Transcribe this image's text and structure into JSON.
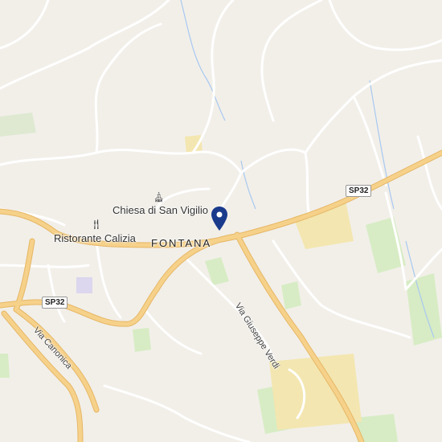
{
  "map": {
    "colors": {
      "background": "#f2efe9",
      "road_main": "#f6d18a",
      "road_minor": "#ffffff",
      "water": "#a8c8f0",
      "green": "#d7ecc4",
      "industrial": "#f3e6b0",
      "pin": "#1a3a8c"
    },
    "places": [
      {
        "id": "church",
        "name": "Chiesa di San Vigilio",
        "icon": "church-icon"
      },
      {
        "id": "restaurant",
        "name": "Ristorante Calizia",
        "icon": "fork-knife-icon"
      }
    ],
    "town": "FONTANA",
    "roads": {
      "sp32_east": "SP32",
      "sp32_west": "SP32",
      "via_verdi": "Via Giuseppe Verdi",
      "via_canonica": "Via Canonica"
    },
    "marker": {
      "icon": "location-pin-icon"
    }
  }
}
